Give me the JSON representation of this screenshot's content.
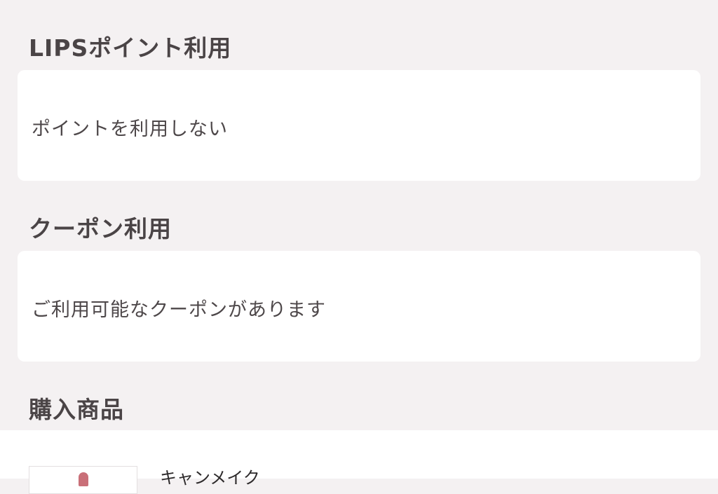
{
  "points_section": {
    "title": "LIPSポイント利用",
    "option_text": "ポイントを利用しない"
  },
  "coupon_section": {
    "title": "クーポン利用",
    "option_text": "ご利用可能なクーポンがあります"
  },
  "products_section": {
    "title": "購入商品",
    "items": [
      {
        "brand": "キャンメイク"
      }
    ]
  },
  "colors": {
    "page_background": "#f4f1f2",
    "card_background": "#ffffff",
    "heading_text": "#4a4446"
  }
}
